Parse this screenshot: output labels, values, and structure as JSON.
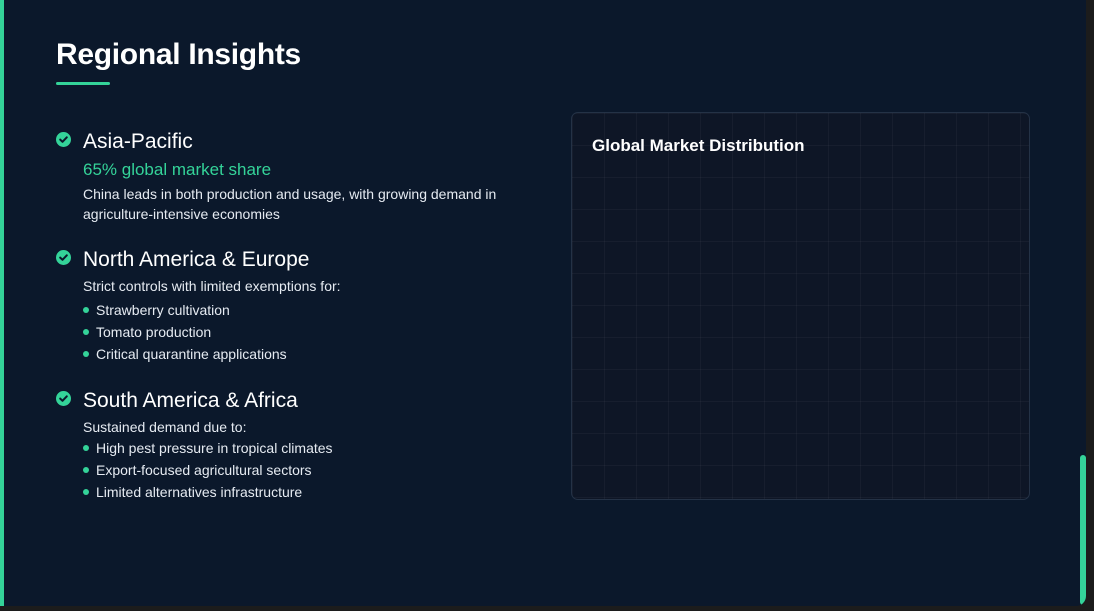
{
  "section": {
    "title": "Regional Insights"
  },
  "regions": [
    {
      "heading": "Asia-Pacific",
      "highlight": "65% global market share",
      "description": "China leads in both production and usage, with growing demand in agriculture-intensive economies"
    },
    {
      "heading": "North America & Europe",
      "description": "Strict controls with limited exemptions for:",
      "bullets": [
        "Strawberry cultivation",
        "Tomato production",
        "Critical quarantine applications"
      ]
    },
    {
      "heading": "South America & Africa",
      "description": "Sustained demand due to:",
      "bullets": [
        "High pest pressure in tropical climates",
        "Export-focused agricultural sectors",
        "Limited alternatives infrastructure"
      ]
    }
  ],
  "chart": {
    "title": "Global Market Distribution"
  },
  "icons": {
    "region_marker": "check-circle-icon",
    "bullet": "bullet-dot-icon"
  },
  "colors": {
    "accent": "#34d399",
    "background": "#0b182b",
    "card_background": "#0e1626",
    "text": "#ffffff"
  }
}
